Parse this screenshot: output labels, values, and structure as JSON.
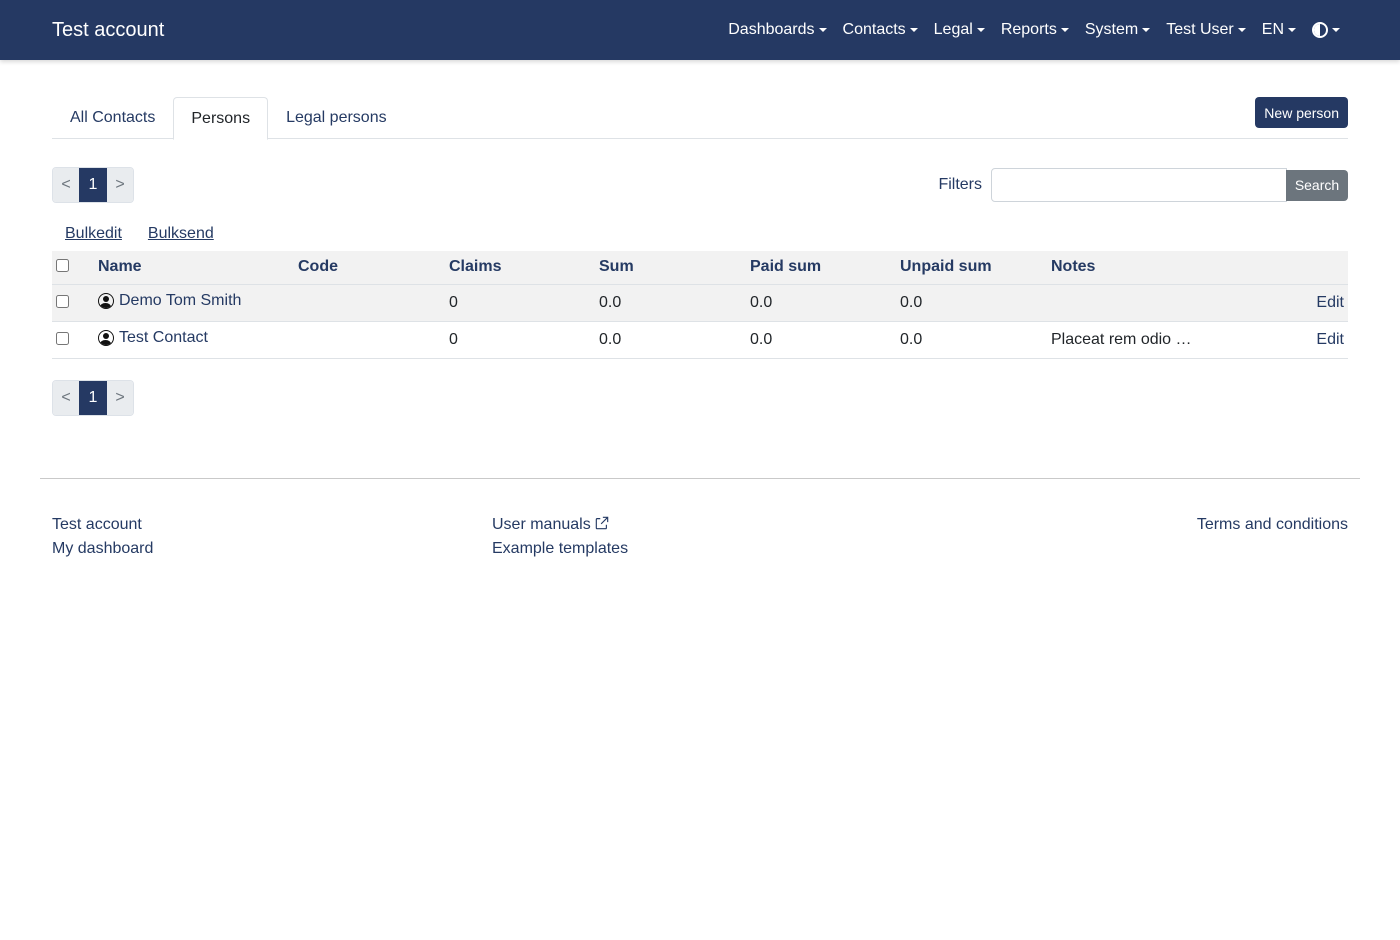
{
  "navbar": {
    "brand": "Test account",
    "menu": [
      {
        "label": "Dashboards"
      },
      {
        "label": "Contacts"
      },
      {
        "label": "Legal"
      },
      {
        "label": "Reports"
      },
      {
        "label": "System"
      },
      {
        "label": "Test User"
      },
      {
        "label": "EN"
      }
    ],
    "theme_icon": "contrast-icon"
  },
  "tabs": [
    {
      "label": "All Contacts",
      "active": false
    },
    {
      "label": "Persons",
      "active": true
    },
    {
      "label": "Legal persons",
      "active": false
    }
  ],
  "new_person_label": "New person",
  "pagination": {
    "prev": "<",
    "current": "1",
    "next": ">"
  },
  "filters": {
    "label": "Filters",
    "value": "",
    "search_label": "Search"
  },
  "bulk": {
    "edit": "Bulkedit",
    "send": "Bulksend"
  },
  "table": {
    "headers": {
      "name": "Name",
      "code": "Code",
      "claims": "Claims",
      "sum": "Sum",
      "paid": "Paid sum",
      "unpaid": "Unpaid sum",
      "notes": "Notes"
    },
    "rows": [
      {
        "name": "Demo Tom Smith",
        "code": "",
        "claims": "0",
        "sum": "0.0",
        "paid": "0.0",
        "unpaid": "0.0",
        "notes": "",
        "edit": "Edit"
      },
      {
        "name": "Test Contact",
        "code": "",
        "claims": "0",
        "sum": "0.0",
        "paid": "0.0",
        "unpaid": "0.0",
        "notes": "Placeat rem odio …",
        "edit": "Edit"
      }
    ]
  },
  "footer": {
    "col1": [
      "Test account",
      "My dashboard"
    ],
    "col2": [
      "User manuals",
      "Example templates"
    ],
    "col3": [
      "Terms and conditions"
    ]
  },
  "colors": {
    "navbar": "#253963",
    "link": "#253a63",
    "secondary": "#6c757d"
  }
}
